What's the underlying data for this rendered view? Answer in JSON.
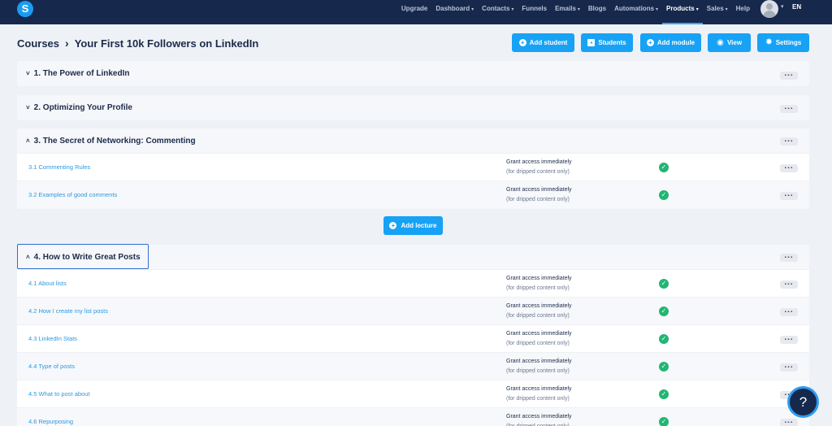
{
  "nav": {
    "logo": "S",
    "items": [
      "Upgrade",
      "Dashboard",
      "Contacts",
      "Funnels",
      "Emails",
      "Blogs",
      "Automations",
      "Products",
      "Sales",
      "Help"
    ],
    "dropdowns": [
      false,
      true,
      true,
      false,
      true,
      false,
      true,
      true,
      true,
      false
    ],
    "active": "Products",
    "lang": "EN"
  },
  "header": {
    "crumb_root": "Courses",
    "crumb_sep": "›",
    "title": "Your First 10k Followers on LinkedIn",
    "buttons": [
      "Add student",
      "Students",
      "Add module",
      "View",
      "Settings"
    ]
  },
  "modules": [
    {
      "title": "1. The Power of LinkedIn",
      "expanded": false
    },
    {
      "title": "2. Optimizing Your Profile",
      "expanded": false
    },
    {
      "title": "3. The Secret of Networking: Commenting",
      "expanded": true,
      "lectures": [
        "3.1 Commenting Rules",
        "3.2 Examples of good comments"
      ]
    },
    {
      "title": "4. How to Write Great Posts",
      "expanded": true,
      "lectures": [
        "4.1 About lists",
        "4.2 How I create my list posts",
        "4.3 LinkedIn Stats",
        "4.4 Type of posts",
        "4.5 What to post about",
        "4.6 Repurposing"
      ]
    }
  ],
  "access": {
    "main": "Grant access immediately",
    "sub": "(for dripped content only)"
  },
  "add_lecture": "Add lecture",
  "colors": {
    "nav_bg": "#17284d",
    "accent": "#17a2f5",
    "success": "#22b573"
  },
  "help_label": "?"
}
